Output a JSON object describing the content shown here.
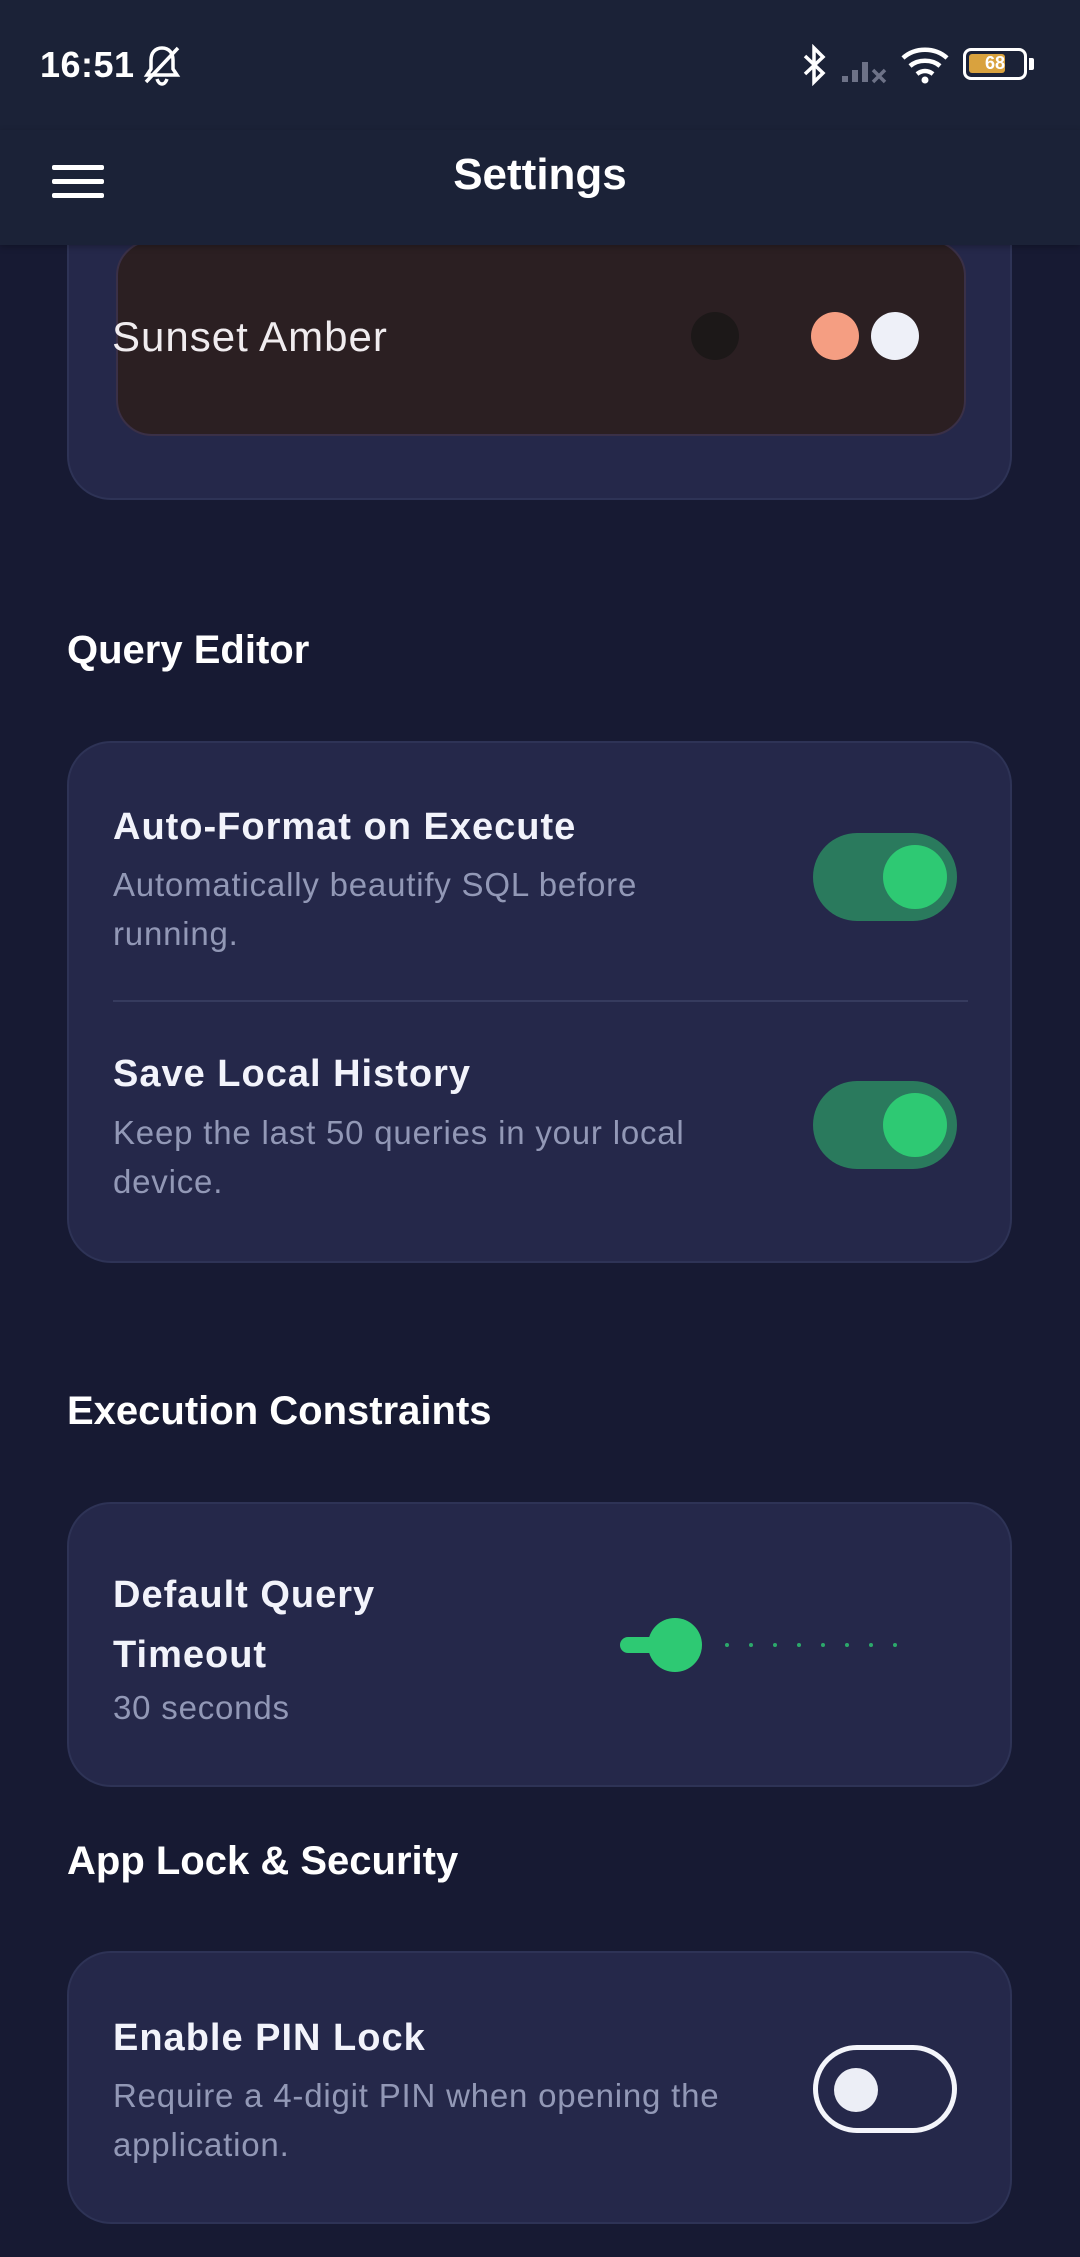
{
  "status_bar": {
    "time": "16:51",
    "battery": "68",
    "icons": [
      "bell-muted-icon",
      "bluetooth-icon",
      "signal-icon",
      "wifi-icon",
      "battery-icon"
    ]
  },
  "app_bar": {
    "title": "Settings",
    "menu_icon": "menu-icon"
  },
  "theme": {
    "selected_name": "Sunset Amber",
    "swatches": [
      "#1c1818",
      "#f59e82",
      "#eef0f8"
    ]
  },
  "query_editor": {
    "section_title": "Query Editor",
    "auto_format": {
      "title": "Auto-Format on Execute",
      "description": "Automatically beautify SQL before running.",
      "enabled": true
    },
    "save_history": {
      "title": "Save Local History",
      "description": "Keep the last 50 queries in your local device.",
      "enabled": true
    }
  },
  "execution_constraints": {
    "section_title": "Execution Constraints",
    "timeout": {
      "title": "Default Query Timeout",
      "value_label": "30 seconds",
      "slider_fraction": 0.1
    }
  },
  "security": {
    "section_title": "App Lock & Security",
    "pin_lock": {
      "title": "Enable PIN Lock",
      "description": "Require a 4-digit PIN when opening the application.",
      "enabled": false
    }
  },
  "colors": {
    "background": "#171a33",
    "card": "#25284a",
    "accent": "#2ec973",
    "appbar": "#1b2237"
  }
}
